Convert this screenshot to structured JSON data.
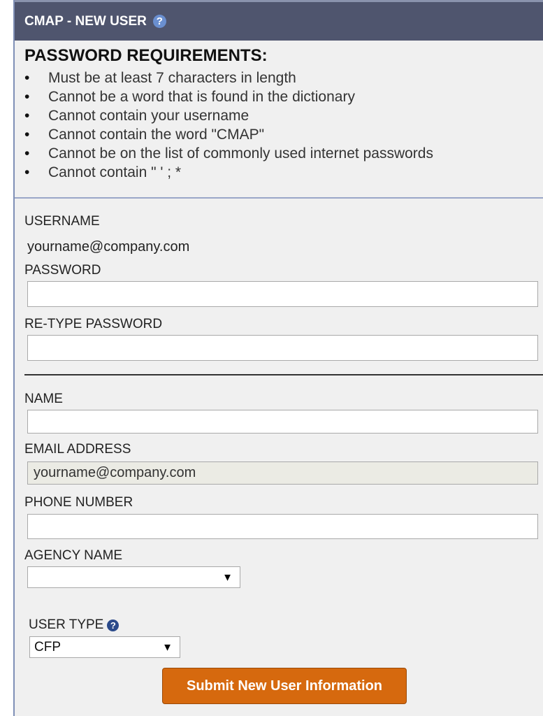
{
  "header": {
    "title": "CMAP - NEW USER"
  },
  "requirements": {
    "title": "PASSWORD REQUIREMENTS:",
    "items": [
      "Must be at least 7 characters in length",
      "Cannot be a word that is found in the dictionary",
      "Cannot contain your username",
      "Cannot contain the word \"CMAP\"",
      "Cannot be on the list of commonly used internet passwords",
      "Cannot contain \" ' ; *"
    ]
  },
  "form": {
    "username_label": "USERNAME",
    "username_value": "yourname@company.com",
    "password_label": "PASSWORD",
    "password_value": "",
    "retype_password_label": "RE-TYPE PASSWORD",
    "retype_password_value": "",
    "name_label": "NAME",
    "name_value": "",
    "email_label": "EMAIL ADDRESS",
    "email_value": "yourname@company.com",
    "phone_label": "PHONE NUMBER",
    "phone_value": "",
    "agency_label": "AGENCY NAME",
    "agency_selected": "",
    "user_type_label": "USER TYPE",
    "user_type_selected": "CFP",
    "submit_label": "Submit New User Information"
  },
  "icons": {
    "help": "?",
    "dropdown_arrow": "▼"
  },
  "colors": {
    "header_bg": "#4f556e",
    "submit_bg": "#d6690e",
    "help_icon": "#6a8fd0"
  }
}
